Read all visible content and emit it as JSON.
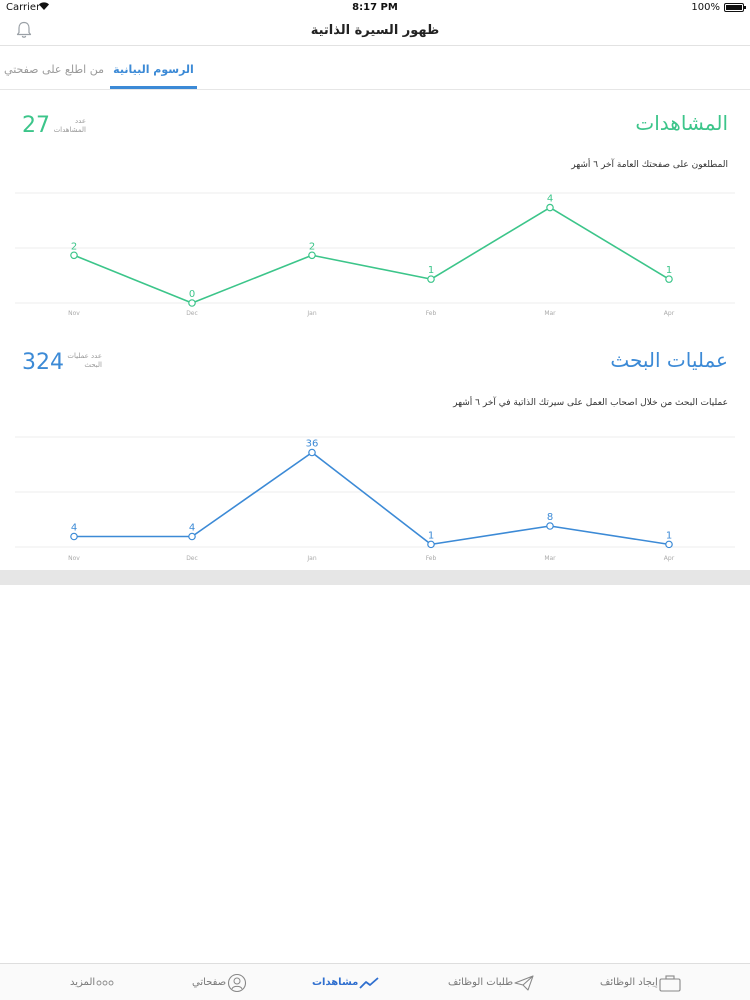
{
  "status_bar": {
    "carrier": "Carrier",
    "time": "8:17 PM",
    "battery": "100%"
  },
  "header": {
    "title": "ظهور السيرة الذاتية"
  },
  "tabs": [
    {
      "label": "الرسوم البيانية",
      "active": true
    },
    {
      "label": "من اطلع على صفحتي",
      "active": false
    }
  ],
  "views": {
    "title": "المشاهدات",
    "subtitle": "المطلعون على صفحتك العامة آخر ٦ أشهر",
    "count": "27",
    "count_label": "عدد المشاهدات",
    "color": "#3cc58a"
  },
  "searches": {
    "title": "عمليات البحث",
    "subtitle": "عمليات البحث من خلال اصحاب العمل على سيرتك الذاتية في آخر ٦ أشهر",
    "count": "324",
    "count_label": "عدد عمليات البحث",
    "color": "#3c8ad6"
  },
  "chart_data": [
    {
      "type": "line",
      "categories": [
        "Nov",
        "Dec",
        "Jan",
        "Feb",
        "Mar",
        "Apr"
      ],
      "values": [
        2,
        0,
        2,
        1,
        4,
        1
      ],
      "title": "المشاهدات",
      "ylim": [
        0,
        4.4
      ],
      "grid": true
    },
    {
      "type": "line",
      "categories": [
        "Nov",
        "Dec",
        "Jan",
        "Feb",
        "Mar",
        "Apr"
      ],
      "values": [
        4,
        4,
        36,
        1,
        8,
        1
      ],
      "title": "عمليات البحث",
      "ylim": [
        0,
        40
      ],
      "grid": true
    }
  ],
  "tabbar": [
    {
      "label": "إيجاد الوظائف",
      "icon": "briefcase-icon",
      "active": false
    },
    {
      "label": "طلبات الوظائف",
      "icon": "paper-plane-icon",
      "active": false
    },
    {
      "label": "مشاهدات",
      "icon": "trend-line-icon",
      "active": true
    },
    {
      "label": "صفحاتي",
      "icon": "profile-icon",
      "active": false
    },
    {
      "label": "المزيد",
      "icon": "more-dots-icon",
      "active": false
    }
  ]
}
